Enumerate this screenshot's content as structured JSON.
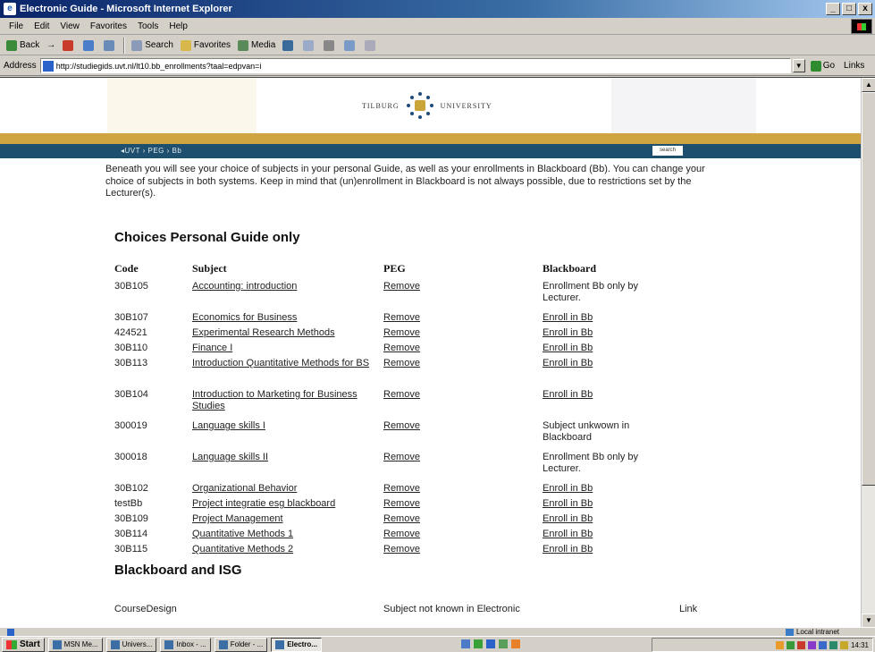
{
  "window": {
    "title": "Electronic Guide - Microsoft Internet Explorer",
    "buttons": {
      "minimize": "_",
      "maximize": "□",
      "close": "x"
    }
  },
  "menubar": [
    "File",
    "Edit",
    "View",
    "Favorites",
    "Tools",
    "Help"
  ],
  "toolbar": {
    "back": "Back",
    "forward": "→",
    "search": "Search",
    "favorites": "Favorites",
    "media": "Media"
  },
  "addressbar": {
    "label": "Address",
    "url": "http://studiegids.uvt.nl/lt10.bb_enrollments?taal=edpvan=i",
    "go": "Go",
    "links": "Links"
  },
  "page": {
    "logo_left": "TILBURG",
    "logo_right": "UNIVERSITY",
    "breadcrumb": "◂UVT › PEG › Bb",
    "search_box": "search",
    "intro": "Beneath you will see your choice of subjects in your personal Guide, as well as your enrollments in Blackboard (Bb). You can change your choice of subjects in both systems. Keep in mind that (un)enrollment in Blackboard is not always possible, due to restrictions set by the Lecturer(s).",
    "section1_title": "Choices Personal Guide only",
    "columns": {
      "code": "Code",
      "subject": "Subject",
      "peg": "PEG",
      "blackboard": "Blackboard"
    },
    "rows": [
      {
        "code": "30B105",
        "subject": "Accounting: introduction",
        "peg": "Remove",
        "blackboard": "Enrollment Bb only by Lecturer.",
        "bb_link": false
      },
      {
        "code": "30B107",
        "subject": "Economics for Business",
        "peg": "Remove",
        "blackboard": "Enroll in Bb",
        "bb_link": true
      },
      {
        "code": "424521",
        "subject": "Experimental Research Methods",
        "peg": "Remove",
        "blackboard": "Enroll in Bb",
        "bb_link": true
      },
      {
        "code": "30B110",
        "subject": "Finance I",
        "peg": "Remove",
        "blackboard": "Enroll in Bb",
        "bb_link": true
      },
      {
        "code": "30B113",
        "subject": "Introduction Quantitative Methods for BS",
        "peg": "Remove",
        "blackboard": "Enroll in Bb",
        "bb_link": true
      },
      {
        "code": "30B104",
        "subject": "Introduction to Marketing for Business Studies",
        "peg": "Remove",
        "blackboard": "Enroll in Bb",
        "bb_link": true
      },
      {
        "code": "300019",
        "subject": "Language skills I",
        "peg": "Remove",
        "blackboard": "Subject unkwown in Blackboard",
        "bb_link": false
      },
      {
        "code": "300018",
        "subject": "Language skills II",
        "peg": "Remove",
        "blackboard": "Enrollment Bb only by Lecturer.",
        "bb_link": false
      },
      {
        "code": "30B102",
        "subject": "Organizational Behavior",
        "peg": "Remove",
        "blackboard": "Enroll in Bb",
        "bb_link": true
      },
      {
        "code": "testBb",
        "subject": "Project integratie esg blackboard",
        "peg": "Remove",
        "blackboard": "Enroll in Bb",
        "bb_link": true
      },
      {
        "code": "30B109",
        "subject": "Project Management",
        "peg": "Remove",
        "blackboard": "Enroll in Bb",
        "bb_link": true
      },
      {
        "code": "30B114",
        "subject": "Quantitative Methods 1",
        "peg": "Remove",
        "blackboard": "Enroll in Bb",
        "bb_link": true
      },
      {
        "code": "30B115",
        "subject": "Quantitative Methods 2",
        "peg": "Remove",
        "blackboard": "Enroll in Bb",
        "bb_link": true
      }
    ],
    "section2_title": "Blackboard and ISG",
    "section2_row": {
      "code": "CourseDesign",
      "peg": "Subject not known in Electronic",
      "blackboard": "Link"
    }
  },
  "statusbar": {
    "zone": "Local intranet"
  },
  "taskbar": {
    "start": "Start",
    "tasks": [
      "MSN Me...",
      "Univers...",
      "Inbox - ...",
      "Folder - ...",
      "Electro..."
    ],
    "active_task_index": 4,
    "clock": "14:31"
  }
}
